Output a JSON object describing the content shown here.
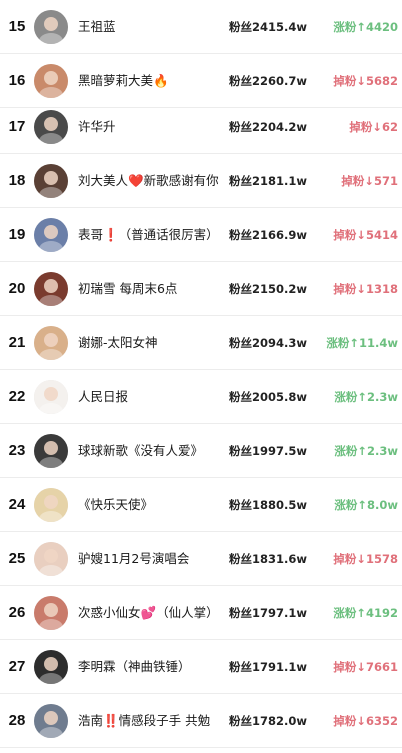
{
  "rows": [
    {
      "rank": "15",
      "name": "王祖蓝",
      "emoji": "",
      "suffix": "",
      "fans": "粉丝2415.4w",
      "change": "涨粉↑4420",
      "dir": "up",
      "avatar_color": "#8a8a8a"
    },
    {
      "rank": "16",
      "name": "黑暗萝莉大美",
      "emoji": "🔥",
      "suffix": "",
      "fans": "粉丝2260.7w",
      "change": "掉粉↓5682",
      "dir": "down",
      "avatar_color": "#c98a6a"
    },
    {
      "rank": "17",
      "name": "许华升",
      "emoji": "",
      "suffix": "",
      "fans": "粉丝2204.2w",
      "change": "掉粉↓62",
      "dir": "down",
      "avatar_color": "#4a4a4a"
    },
    {
      "rank": "18",
      "name": "刘大美人",
      "emoji": "❤️",
      "suffix": "新歌感谢有你",
      "fans": "粉丝2181.1w",
      "change": "掉粉↓571",
      "dir": "down",
      "avatar_color": "#5a4035"
    },
    {
      "rank": "19",
      "name": "表哥",
      "emoji": "❗",
      "suffix": "（普通话很厉害）",
      "fans": "粉丝2166.9w",
      "change": "掉粉↓5414",
      "dir": "down",
      "avatar_color": "#6b7fa8"
    },
    {
      "rank": "20",
      "name": "初瑞雪 每周末6点",
      "emoji": "",
      "suffix": "",
      "fans": "粉丝2150.2w",
      "change": "掉粉↓1318",
      "dir": "down",
      "avatar_color": "#7a3b2e"
    },
    {
      "rank": "21",
      "name": "谢娜-太阳女神",
      "emoji": "",
      "suffix": "",
      "fans": "粉丝2094.3w",
      "change": "涨粉↑11.4w",
      "dir": "up",
      "avatar_color": "#d9b08a"
    },
    {
      "rank": "22",
      "name": "人民日报",
      "emoji": "",
      "suffix": "",
      "fans": "粉丝2005.8w",
      "change": "涨粉↑2.3w",
      "dir": "up",
      "avatar_color": "#f4f1ee"
    },
    {
      "rank": "23",
      "name": "球球新歌《没有人爱》",
      "emoji": "",
      "suffix": "",
      "fans": "粉丝1997.5w",
      "change": "涨粉↑2.3w",
      "dir": "up",
      "avatar_color": "#3a3a3a"
    },
    {
      "rank": "24",
      "name": "《快乐天使》",
      "emoji": "",
      "suffix": "",
      "fans": "粉丝1880.5w",
      "change": "涨粉↑8.0w",
      "dir": "up",
      "avatar_color": "#e6d3a8"
    },
    {
      "rank": "25",
      "name": "驴嫂11月2号演唱会",
      "emoji": "",
      "suffix": "",
      "fans": "粉丝1831.6w",
      "change": "掉粉↓1578",
      "dir": "down",
      "avatar_color": "#e9cfc0"
    },
    {
      "rank": "26",
      "name": "次惑小仙女",
      "emoji": "💕",
      "suffix": "（仙人掌）",
      "fans": "粉丝1797.1w",
      "change": "涨粉↑4192",
      "dir": "up",
      "avatar_color": "#c97b6b"
    },
    {
      "rank": "27",
      "name": "李明霖（神曲铁锤）",
      "emoji": "",
      "suffix": "",
      "fans": "粉丝1791.1w",
      "change": "掉粉↓7661",
      "dir": "down",
      "avatar_color": "#2d2d2d"
    },
    {
      "rank": "28",
      "name": "浩南",
      "emoji": "‼️",
      "suffix": "情感段子手 共勉",
      "fans": "粉丝1782.0w",
      "change": "掉粉↓6352",
      "dir": "down",
      "avatar_color": "#6f7c8f"
    }
  ],
  "colors": {
    "up": "#6cbf7f",
    "down": "#e0707a"
  }
}
